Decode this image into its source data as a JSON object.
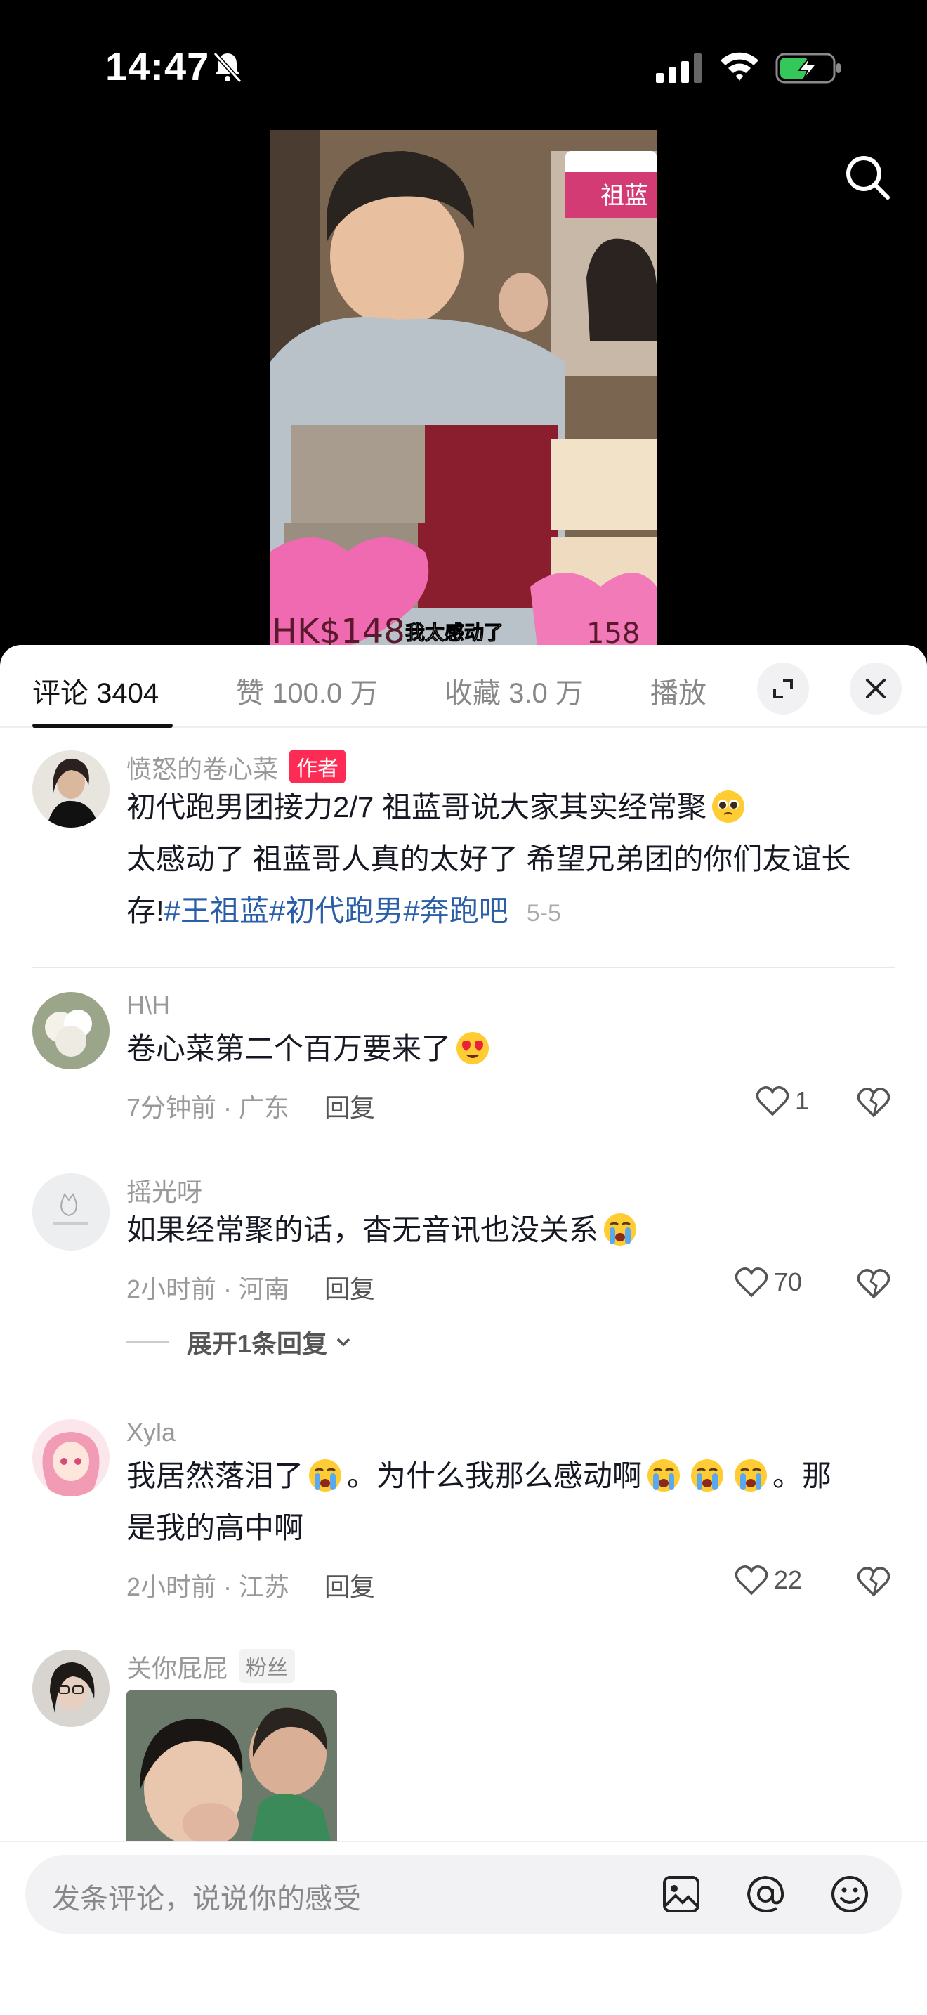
{
  "status": {
    "time": "14:47"
  },
  "video": {
    "caption": "我太感动了",
    "sign_text": "祖蓝",
    "price_left": "HK$148",
    "price_right": "158"
  },
  "tabs": [
    {
      "label": "评论 3404"
    },
    {
      "label": "赞 100.0 万"
    },
    {
      "label": "收藏 3.0 万"
    },
    {
      "label": "播放"
    }
  ],
  "comments": [
    {
      "username": "愤怒的卷心菜",
      "tag": "作者",
      "text_1": "初代跑男团接力2/7 祖蓝哥说大家其实经常聚",
      "text_2": "太感动了 祖蓝哥人真的太好了 希望兄弟团的你们友谊长",
      "text_3_prefix": "存!",
      "hashtags": [
        "#王祖蓝",
        "#初代跑男",
        "#奔跑吧"
      ],
      "date": "5-5"
    },
    {
      "username": "H\\H",
      "text": "卷心菜第二个百万要来了",
      "meta": "7分钟前 · 广东",
      "reply_label": "回复",
      "likes": "1"
    },
    {
      "username": "摇光呀",
      "text": "如果经常聚的话，杳无音讯也没关系",
      "meta": "2小时前 · 河南",
      "reply_label": "回复",
      "likes": "70",
      "expand_label": "展开1条回复"
    },
    {
      "username": "Xyla",
      "text_a": "我居然落泪了",
      "text_b": "。为什么我那么感动啊",
      "text_c": "。那",
      "text_d": "是我的高中啊",
      "meta": "2小时前 · 江苏",
      "reply_label": "回复",
      "likes": "22"
    },
    {
      "username": "关你屁屁",
      "tag": "粉丝"
    }
  ],
  "input": {
    "placeholder": "发条评论，说说你的感受"
  },
  "colors": {
    "author_tag": "#fe2c55",
    "hashtag": "#2a5ea8"
  }
}
